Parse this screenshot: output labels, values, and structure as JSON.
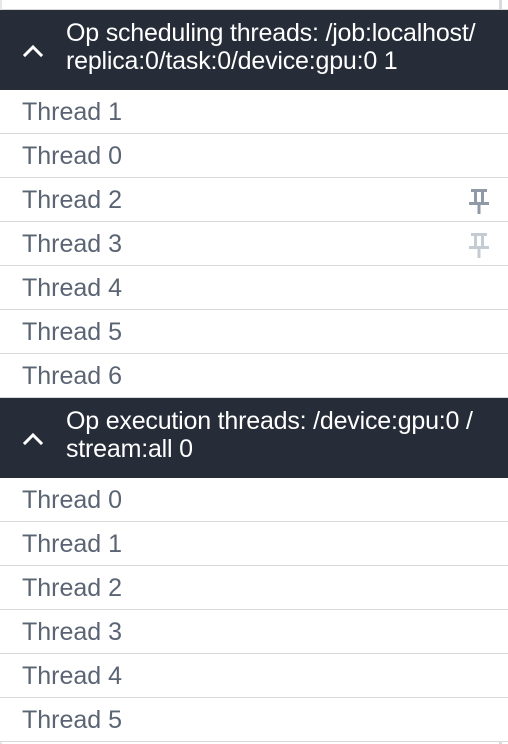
{
  "groups": [
    {
      "title": "Op scheduling threads: /job:localhost/replica:0/task:0/device:gpu:0 1",
      "rows": [
        {
          "label": "Thread 1",
          "pin": "none"
        },
        {
          "label": "Thread 0",
          "pin": "none"
        },
        {
          "label": "Thread 2",
          "pin": "pinned"
        },
        {
          "label": "Thread 3",
          "pin": "hover"
        },
        {
          "label": "Thread 4",
          "pin": "none"
        },
        {
          "label": "Thread 5",
          "pin": "none"
        },
        {
          "label": "Thread 6",
          "pin": "none"
        }
      ]
    },
    {
      "title": "Op execution threads: /device:gpu:0 /stream:all 0",
      "rows": [
        {
          "label": "Thread 0",
          "pin": "none"
        },
        {
          "label": "Thread 1",
          "pin": "none"
        },
        {
          "label": "Thread 2",
          "pin": "none"
        },
        {
          "label": "Thread 3",
          "pin": "none"
        },
        {
          "label": "Thread 4",
          "pin": "none"
        },
        {
          "label": "Thread 5",
          "pin": "none"
        }
      ]
    }
  ],
  "colors": {
    "header_bg": "#262c38",
    "row_text": "#5b6473",
    "pin_active": "#8f9aa6",
    "pin_faint": "#c4cbd3"
  },
  "icons": {
    "collapse": "chevron-up-icon",
    "pin": "pin-icon"
  }
}
